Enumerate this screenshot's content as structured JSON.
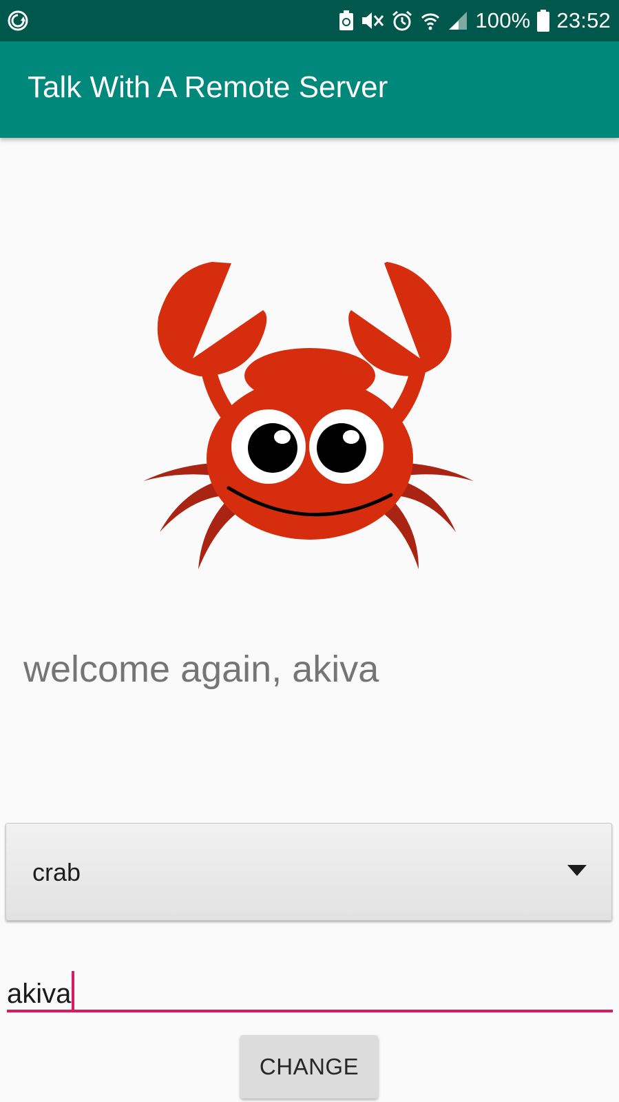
{
  "status_bar": {
    "battery": "100%",
    "time": "23:52",
    "icons": [
      "sync-icon",
      "battery-saver-icon",
      "mute-icon",
      "alarm-icon",
      "wifi-icon",
      "signal-icon",
      "battery-icon"
    ]
  },
  "app_bar": {
    "title": "Talk With A Remote Server"
  },
  "main": {
    "image": "crab-illustration",
    "welcome_text": "welcome again, akiva",
    "spinner": {
      "selected": "crab"
    },
    "name_field": {
      "value": "akiva"
    },
    "change_button": "CHANGE"
  },
  "colors": {
    "status_bar": "#00574b",
    "app_bar": "#00897b",
    "accent": "#d81b60",
    "crab_body": "#d62d0f",
    "crab_legs": "#a92412"
  }
}
